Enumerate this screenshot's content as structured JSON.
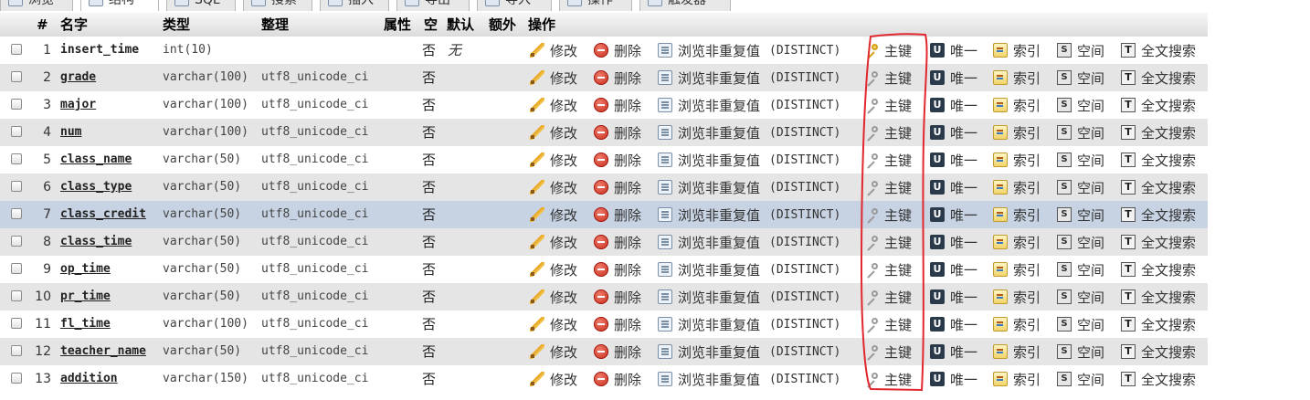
{
  "tabs": [
    {
      "label": "浏览",
      "active": false
    },
    {
      "label": "结构",
      "active": true
    },
    {
      "label": "SQL",
      "active": false
    },
    {
      "label": "搜索",
      "active": false
    },
    {
      "label": "插入",
      "active": false
    },
    {
      "label": "导出",
      "active": false
    },
    {
      "label": "导入",
      "active": false
    },
    {
      "label": "操作",
      "active": false
    },
    {
      "label": "触发器",
      "active": false
    }
  ],
  "table": {
    "headers": {
      "num": "#",
      "name": "名字",
      "type": "类型",
      "collation": "整理",
      "attributes": "属性",
      "null": "空",
      "default": "默认",
      "extra": "额外",
      "action": "操作"
    },
    "rows": [
      {
        "num": "1",
        "name": "insert_time",
        "type": "int(10)",
        "collation": "",
        "null": "否",
        "default": "无",
        "primary": true
      },
      {
        "num": "2",
        "name": "grade",
        "type": "varchar(100)",
        "collation": "utf8_unicode_ci",
        "null": "否",
        "default": ""
      },
      {
        "num": "3",
        "name": "major",
        "type": "varchar(100)",
        "collation": "utf8_unicode_ci",
        "null": "否",
        "default": ""
      },
      {
        "num": "4",
        "name": "num",
        "type": "varchar(100)",
        "collation": "utf8_unicode_ci",
        "null": "否",
        "default": ""
      },
      {
        "num": "5",
        "name": "class_name",
        "type": "varchar(50)",
        "collation": "utf8_unicode_ci",
        "null": "否",
        "default": ""
      },
      {
        "num": "6",
        "name": "class_type",
        "type": "varchar(50)",
        "collation": "utf8_unicode_ci",
        "null": "否",
        "default": ""
      },
      {
        "num": "7",
        "name": "class_credit",
        "type": "varchar(50)",
        "collation": "utf8_unicode_ci",
        "null": "否",
        "default": "",
        "highlighted": true
      },
      {
        "num": "8",
        "name": "class_time",
        "type": "varchar(50)",
        "collation": "utf8_unicode_ci",
        "null": "否",
        "default": ""
      },
      {
        "num": "9",
        "name": "op_time",
        "type": "varchar(50)",
        "collation": "utf8_unicode_ci",
        "null": "否",
        "default": ""
      },
      {
        "num": "10",
        "name": "pr_time",
        "type": "varchar(50)",
        "collation": "utf8_unicode_ci",
        "null": "否",
        "default": ""
      },
      {
        "num": "11",
        "name": "fl_time",
        "type": "varchar(100)",
        "collation": "utf8_unicode_ci",
        "null": "否",
        "default": ""
      },
      {
        "num": "12",
        "name": "teacher_name",
        "type": "varchar(50)",
        "collation": "utf8_unicode_ci",
        "null": "否",
        "default": ""
      },
      {
        "num": "13",
        "name": "addition",
        "type": "varchar(150)",
        "collation": "utf8_unicode_ci",
        "null": "否",
        "default": ""
      }
    ]
  },
  "actions": {
    "edit": "修改",
    "drop": "删除",
    "browse": "浏览非重复值",
    "distinct": "(DISTINCT)",
    "primary": "主键",
    "unique": "唯一",
    "index": "索引",
    "spatial": "空间",
    "fulltext": "全文搜索"
  },
  "colors": {
    "highlight_row": "#c7d3e2",
    "even_row": "#e5e5e5",
    "annotation": "#e0282e"
  }
}
